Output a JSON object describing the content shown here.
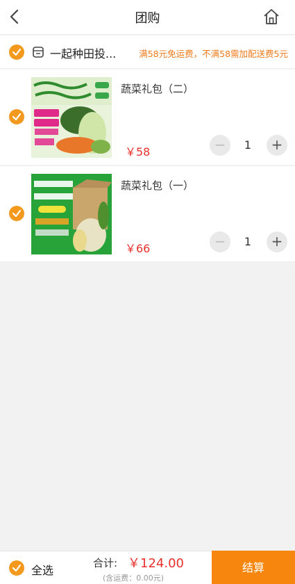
{
  "header": {
    "title": "团购",
    "back_icon": "back-arrow-icon",
    "home_icon": "home-icon"
  },
  "store": {
    "name": "一起种田投...",
    "shipping_note": "满58元免运费，不满58需加配送费5元",
    "checked": true
  },
  "items": [
    {
      "name": "蔬菜礼包（二）",
      "price": "￥58",
      "quantity": "1",
      "checked": true,
      "minus": "−",
      "plus": "+"
    },
    {
      "name": "蔬菜礼包（一）",
      "price": "￥66",
      "quantity": "1",
      "checked": true,
      "minus": "−",
      "plus": "+"
    }
  ],
  "footer": {
    "select_all": "全选",
    "total_label": "合计:",
    "total_amount": "￥124.00",
    "shipping_fee": "(含运费：0.00元)",
    "checkout": "结算"
  },
  "colors": {
    "accent": "#f39a1e",
    "price": "#e8312d",
    "checkout_bg": "#f7860f",
    "note": "#f07a1a"
  }
}
